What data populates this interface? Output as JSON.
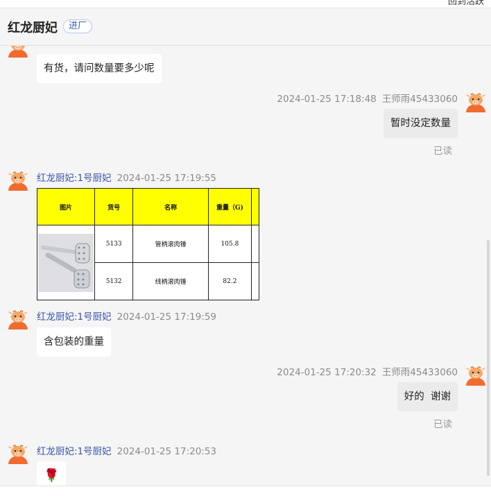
{
  "top_bar": {
    "cut_text": "回到活跃"
  },
  "header": {
    "title": "红龙厨妃",
    "badge": "进厂"
  },
  "messages": [
    {
      "text": "有货，请问数量要多少呢"
    },
    {
      "time": "2024-01-25 17:18:48",
      "sender": "王师雨45433060",
      "text": "暂时没定数量",
      "status": "已读"
    },
    {
      "sender": "红龙厨妃:1号厨妃",
      "time": "2024-01-25 17:19:55",
      "table": {
        "headers": [
          "图片",
          "货号",
          "名称",
          "重量（G)",
          ""
        ],
        "rows": [
          {
            "code": "5133",
            "name": "管柄滚肉锤",
            "weight": "105.8"
          },
          {
            "code": "5132",
            "name": "线柄滚肉锤",
            "weight": "82.2"
          }
        ]
      }
    },
    {
      "sender": "红龙厨妃:1号厨妃",
      "time": "2024-01-25 17:19:59",
      "text": "含包装的重量"
    },
    {
      "time": "2024-01-25 17:20:32",
      "sender": "王师雨45433060",
      "text": "好的  谢谢",
      "status": "已读"
    },
    {
      "sender": "红龙厨妃:1号厨妃",
      "time": "2024-01-25 17:20:53",
      "emoji": "🌹"
    }
  ],
  "colors": {
    "sender_blue": "#3b55a8",
    "table_header_yellow": "#ffff00",
    "avatar_orange": "#f07a3a"
  }
}
